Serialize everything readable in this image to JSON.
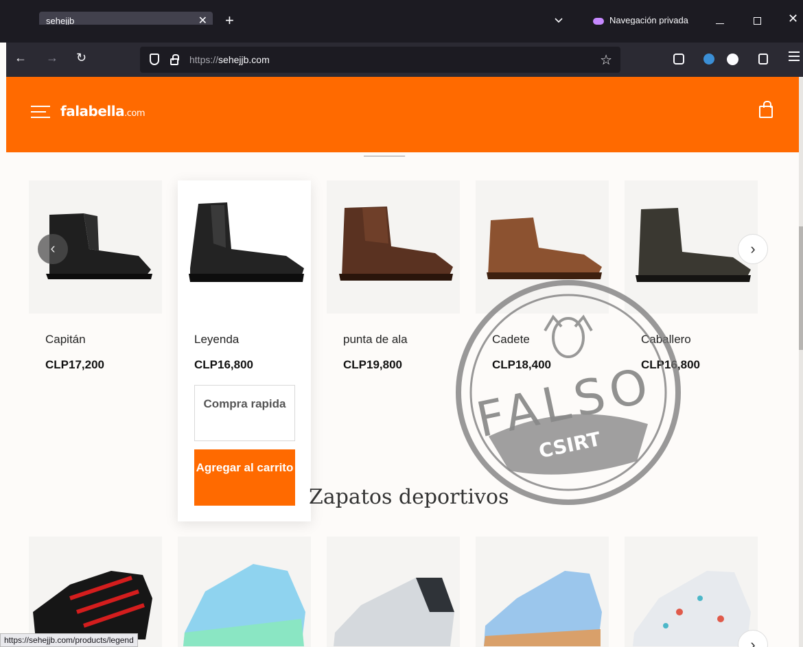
{
  "browser": {
    "tab_title": "sehejjb",
    "private_label": "Navegación privada",
    "url_scheme": "https://",
    "url_host": "sehejjb.com",
    "status_url": "https://sehejjb.com/products/legend"
  },
  "site": {
    "logo": "falabella",
    "logo_suffix": ".com",
    "accent_color": "#ff6a00"
  },
  "products": [
    {
      "name": "Capitán",
      "price": "CLP17,200"
    },
    {
      "name": "Leyenda",
      "price": "CLP16,800",
      "quick_buy_label": "Compra rapida",
      "add_to_cart_label": "Agregar al carrito"
    },
    {
      "name": "punta de ala",
      "price": "CLP19,800"
    },
    {
      "name": "Cadete",
      "price": "CLP18,400"
    },
    {
      "name": "Caballero",
      "price": "CLP16,800"
    }
  ],
  "section": {
    "title": "Zapatos deportivos"
  },
  "stamp": {
    "text": "FALSO",
    "badge": "CSIRT"
  }
}
